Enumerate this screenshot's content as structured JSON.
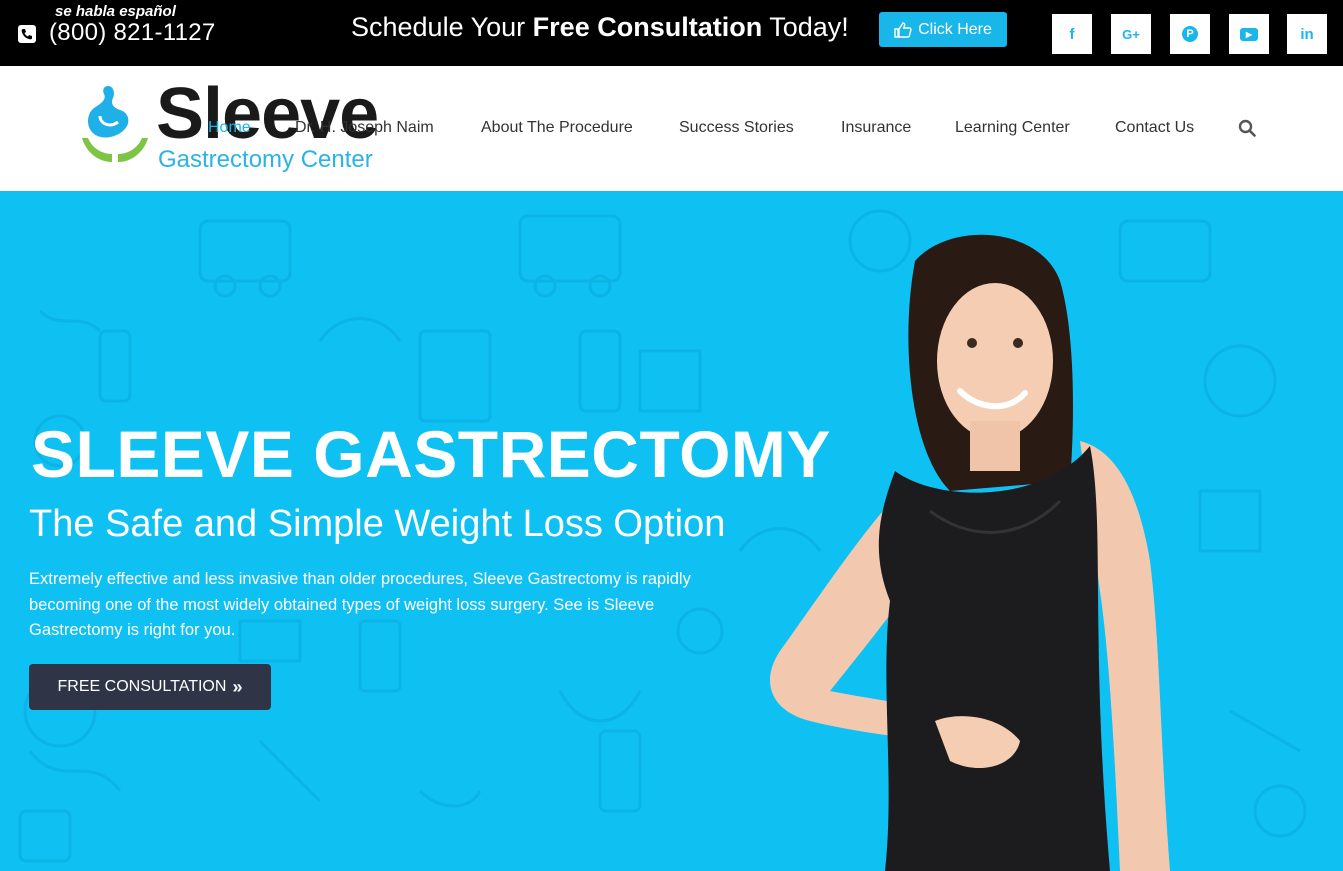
{
  "topbar": {
    "espanol": "se habla español",
    "phone": "(800) 821-1127",
    "schedule_pre": "Schedule Your",
    "schedule_bold": "Free Consultation",
    "schedule_post": "Today!",
    "click_label": "Click Here",
    "social": [
      {
        "label": "f",
        "icon": "facebook-icon"
      },
      {
        "label": "G+",
        "icon": "google-plus-icon"
      },
      {
        "label": "P",
        "icon": "pinterest-icon"
      },
      {
        "label": "▶",
        "icon": "youtube-icon"
      },
      {
        "label": "in",
        "icon": "linkedin-icon"
      }
    ]
  },
  "header": {
    "logo_main": "Sleeve",
    "logo_sub": "Gastrectomy Center",
    "nav": [
      {
        "label": "Home",
        "active": true
      },
      {
        "label": "Dr. H. Joseph Naim",
        "active": false
      },
      {
        "label": "About The Procedure",
        "active": false
      },
      {
        "label": "Success Stories",
        "active": false
      },
      {
        "label": "Insurance",
        "active": false
      },
      {
        "label": "Learning Center",
        "active": false
      },
      {
        "label": "Contact Us",
        "active": false
      }
    ]
  },
  "hero": {
    "title": "SLEEVE GASTRECTOMY",
    "subtitle": "The Safe and Simple Weight Loss Option",
    "description": "Extremely effective and less invasive than older procedures, Sleeve Gastrectomy is rapidly becoming one of the most widely obtained types of weight loss surgery. See is Sleeve Gastrectomy is right for you.",
    "cta_label": "FREE CONSULTATION"
  },
  "colors": {
    "accent": "#19b6ea",
    "hero_bg": "#0fc0f3",
    "cta_bg": "#2f3547",
    "topbar_bg": "#000000"
  }
}
